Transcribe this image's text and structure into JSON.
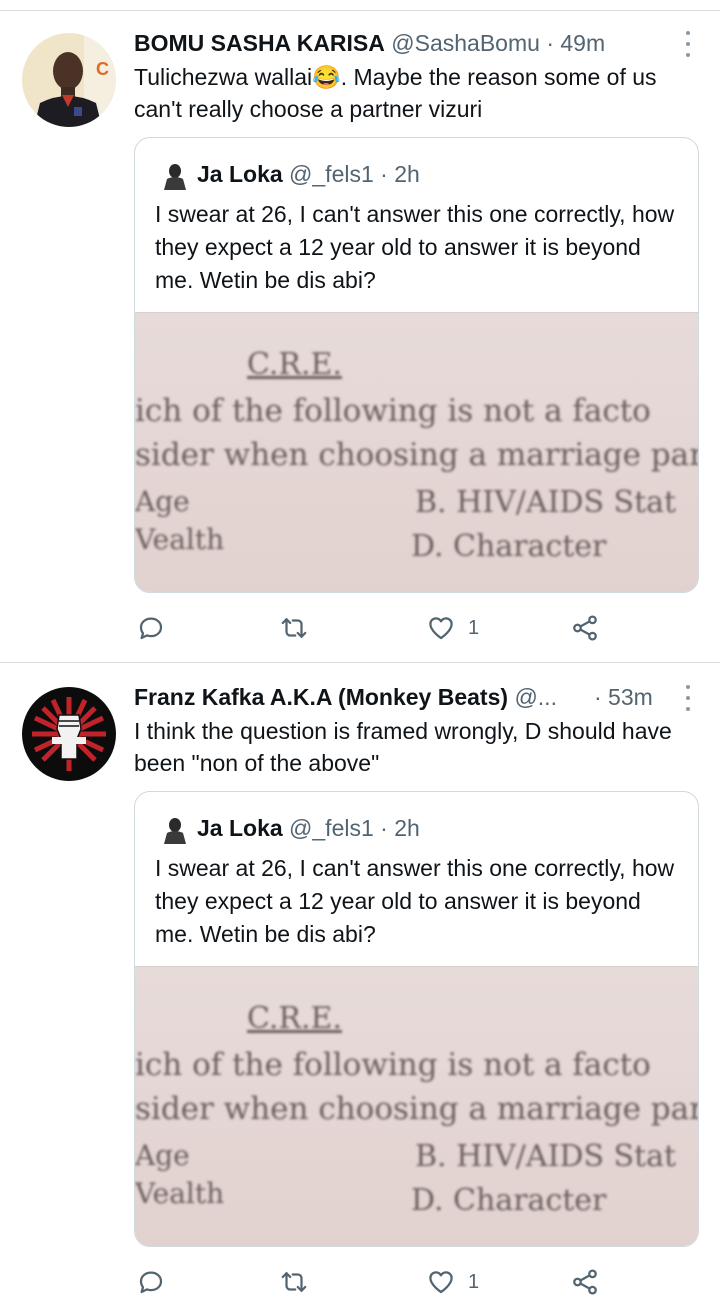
{
  "tweets": [
    {
      "name": "BOMU SASHA KARISA",
      "handle": "@SashaBomu",
      "time": "· 49m",
      "text": "Tulichezwa wallai😂. Maybe the reason some of us can't really choose a partner vizuri",
      "quote": {
        "name": "Ja Loka",
        "handle": "@_fels1",
        "time": "· 2h",
        "text": "I swear at 26, I can't answer this one correctly, how they expect a 12 year old to answer it is beyond me. Wetin be dis abi?",
        "image_lines": [
          "C.R.E.",
          "ich of the following is not a facto",
          "sider when choosing a marriage partr",
          "Age",
          "B. HIV/AIDS Stat",
          "Vealth",
          "D. Character"
        ]
      },
      "actions": {
        "reply_count": "",
        "retweet_count": "",
        "like_count": "1"
      }
    },
    {
      "name": "Franz Kafka A.K.A (Monkey Beats)",
      "handle": "@...",
      "time": "· 53m",
      "text": "I think the question is framed wrongly, D should have been \"non of the above\"",
      "quote": {
        "name": "Ja Loka",
        "handle": "@_fels1",
        "time": "· 2h",
        "text": "I swear at 26, I can't answer this one correctly, how they expect a 12 year old to answer it is beyond me. Wetin be dis abi?",
        "image_lines": [
          "C.R.E.",
          "ich of the following is not a facto",
          "sider when choosing a marriage partr",
          "Age",
          "B. HIV/AIDS Stat",
          "Vealth",
          "D. Character"
        ]
      },
      "actions": {
        "reply_count": "",
        "retweet_count": "",
        "like_count": "1"
      }
    }
  ],
  "colors": {
    "text": "#0f1419",
    "secondary": "#536471",
    "border": "#cfd9de"
  },
  "icons": [
    "more-icon",
    "reply-icon",
    "retweet-icon",
    "like-icon",
    "share-icon"
  ]
}
